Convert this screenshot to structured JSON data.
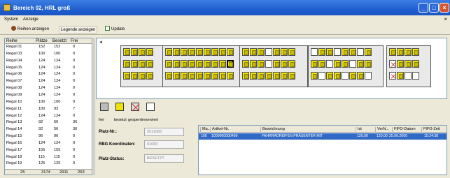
{
  "window": {
    "title": "Bereich 02, HRL groß"
  },
  "menu": [
    "System",
    "Anzeige"
  ],
  "toolbar": {
    "show_rows": "Reihen anzeigen",
    "show_legend": "Legende anzeigen",
    "update": "Update"
  },
  "left_table": {
    "columns": [
      "Reihe",
      "Plätze",
      "Besetzt",
      "Frei"
    ],
    "rows": [
      [
        "Regal 01",
        "152",
        "152",
        "0"
      ],
      [
        "Regal 03",
        "100",
        "100",
        "0"
      ],
      [
        "Regal 04",
        "124",
        "124",
        "0"
      ],
      [
        "Regal 05",
        "124",
        "124",
        "0"
      ],
      [
        "Regal 06",
        "124",
        "124",
        "0"
      ],
      [
        "Regal 07",
        "124",
        "124",
        "0"
      ],
      [
        "Regal 08",
        "124",
        "124",
        "0"
      ],
      [
        "Regal 09",
        "124",
        "124",
        "0"
      ],
      [
        "Regal 10",
        "100",
        "100",
        "0"
      ],
      [
        "Regal 11",
        "100",
        "93",
        "7"
      ],
      [
        "Regal 12",
        "124",
        "124",
        "0"
      ],
      [
        "Regal 13",
        "92",
        "56",
        "36"
      ],
      [
        "Regal 14",
        "92",
        "56",
        "36"
      ],
      [
        "Regal 15",
        "96",
        "96",
        "0"
      ],
      [
        "Regal 16",
        "124",
        "124",
        "0"
      ],
      [
        "Regal 17",
        "155",
        "155",
        "0"
      ],
      [
        "Regal 18",
        "115",
        "115",
        "0"
      ],
      [
        "Regal 19",
        "125",
        "125",
        "0"
      ]
    ],
    "summary": [
      "25",
      "3174",
      "2911",
      "263"
    ]
  },
  "legend": {
    "free": "frei",
    "occupied": "besetzt",
    "blocked": "gesperrt",
    "reserved": "reserviert"
  },
  "form": {
    "slot_label": "Platz-Nr.:",
    "slot_value": "2011083",
    "rbg_label": "RBG Koordinaten:",
    "rbg_value": "01083",
    "status_label": "Platz-Status:",
    "status_value": "BESETZT"
  },
  "right_table": {
    "columns": [
      "Ma...",
      "Artikel-Nr.",
      "Bezeichnung",
      "Ist",
      "VerN...",
      "FIFO-Datum",
      "FIFO-Zeit"
    ],
    "selected_row": [
      "100",
      "1000000000499",
      "FAHRRADREIFEN PRÄSENTER MIT",
      "120,00",
      "120,00",
      "25.06.2000",
      "15:24:38"
    ]
  },
  "colors": {
    "titlebar": "#1f5fd0",
    "occupied": "#efe400",
    "selection": "#316ac5",
    "blocked_mark": "#d03030"
  }
}
